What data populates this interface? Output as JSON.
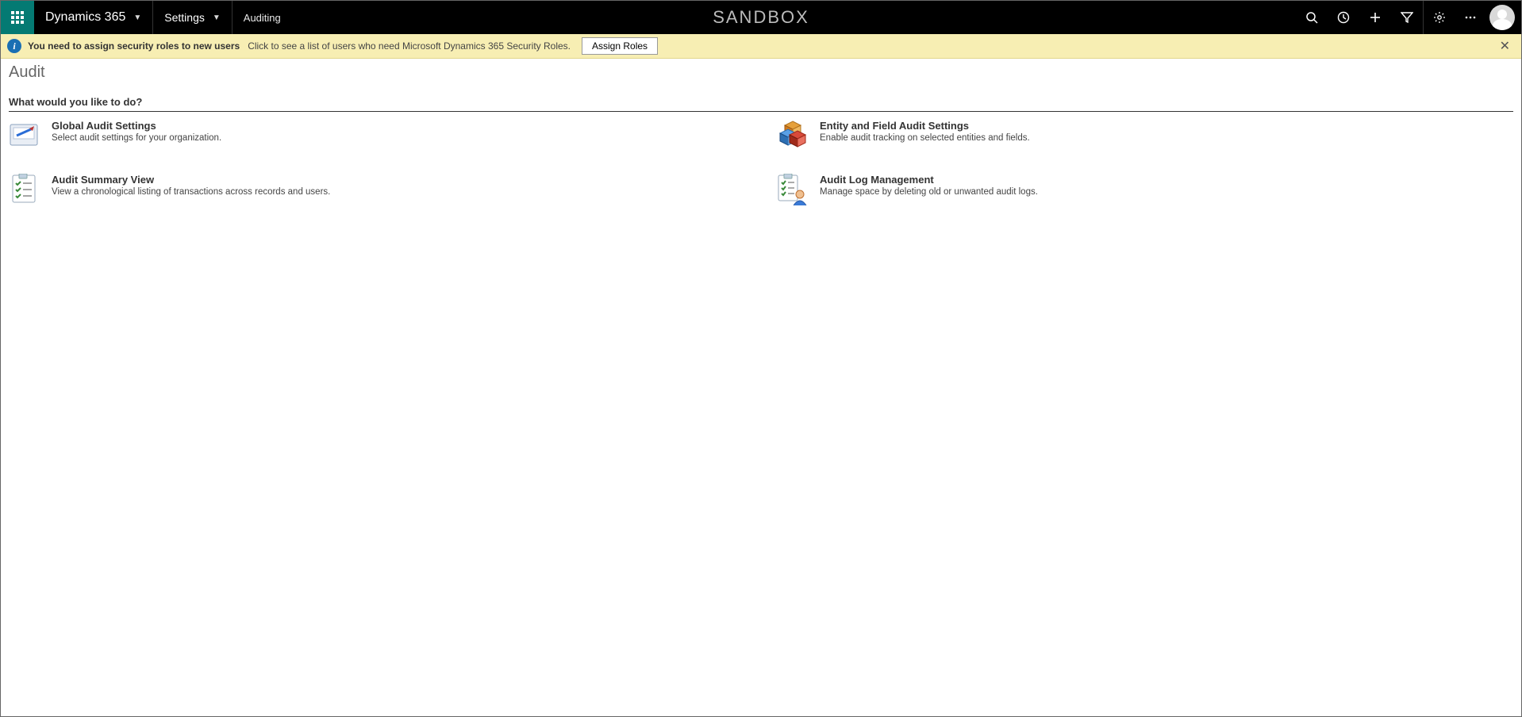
{
  "colors": {
    "accent_teal": "#047a73",
    "notif_bg": "#f7eeb3",
    "info_blue": "#1a6fb3"
  },
  "topbar": {
    "app_name": "Dynamics 365",
    "nav_settings": "Settings",
    "breadcrumb": "Auditing",
    "env_label": "SANDBOX"
  },
  "notification": {
    "bold_text": "You need to assign security roles to new users",
    "message": "Click to see a list of users who need Microsoft Dynamics 365 Security Roles.",
    "button_label": "Assign Roles"
  },
  "page": {
    "title": "Audit",
    "section_header": "What would you like to do?"
  },
  "cards": [
    {
      "title": "Global Audit Settings",
      "description": "Select audit settings for your organization."
    },
    {
      "title": "Entity and Field Audit Settings",
      "description": "Enable audit tracking on selected entities and fields."
    },
    {
      "title": "Audit Summary View",
      "description": "View a chronological listing of transactions across records and users."
    },
    {
      "title": "Audit Log Management",
      "description": "Manage space by deleting old or unwanted audit logs."
    }
  ]
}
